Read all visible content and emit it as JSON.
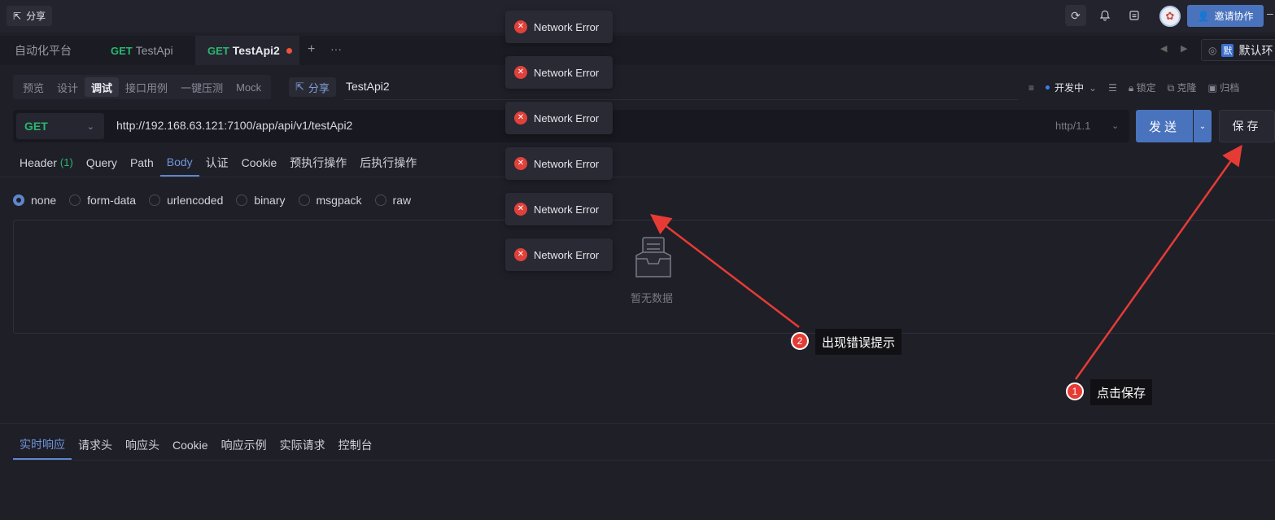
{
  "topbar": {
    "share_label": "分享",
    "invite_label": "邀请协作"
  },
  "tabs": {
    "platform": "自动化平台",
    "tab1_method": "GET",
    "tab1_name": "TestApi",
    "tab2_method": "GET",
    "tab2_name": "TestApi2",
    "add": "+",
    "more": "···",
    "env_badge": "默",
    "env_name": "默认环"
  },
  "modebar": {
    "items": [
      "预览",
      "设计",
      "调试",
      "接口用例",
      "一键压测",
      "Mock"
    ],
    "share": "分享",
    "api_name": "TestApi2",
    "status": "开发中",
    "lock": "锁定",
    "clone": "克隆",
    "archive": "归档"
  },
  "request": {
    "method": "GET",
    "url": "http://192.168.63.121:7100/app/api/v1/testApi2",
    "http_version": "http/1.1",
    "send_label": "发送",
    "save_label": "保存"
  },
  "req_tabs": {
    "header": "Header",
    "header_count": "(1)",
    "query": "Query",
    "path": "Path",
    "body": "Body",
    "auth": "认证",
    "cookie": "Cookie",
    "pre": "预执行操作",
    "post": "后执行操作"
  },
  "body_types": [
    "none",
    "form-data",
    "urlencoded",
    "binary",
    "msgpack",
    "raw"
  ],
  "empty_text": "暂无数据",
  "resp_tabs": [
    "实时响应",
    "请求头",
    "响应头",
    "Cookie",
    "响应示例",
    "实际请求",
    "控制台"
  ],
  "toasts": [
    "Network Error",
    "Network Error",
    "Network Error",
    "Network Error",
    "Network Error",
    "Network Error"
  ],
  "annotations": {
    "a1_num": "1",
    "a1_text": "点击保存",
    "a2_num": "2",
    "a2_text": "出现错误提示"
  },
  "colors": {
    "accent": "#4a73bd",
    "get_method": "#27b86e",
    "error": "#e0413a",
    "arrow": "#e63b35"
  }
}
